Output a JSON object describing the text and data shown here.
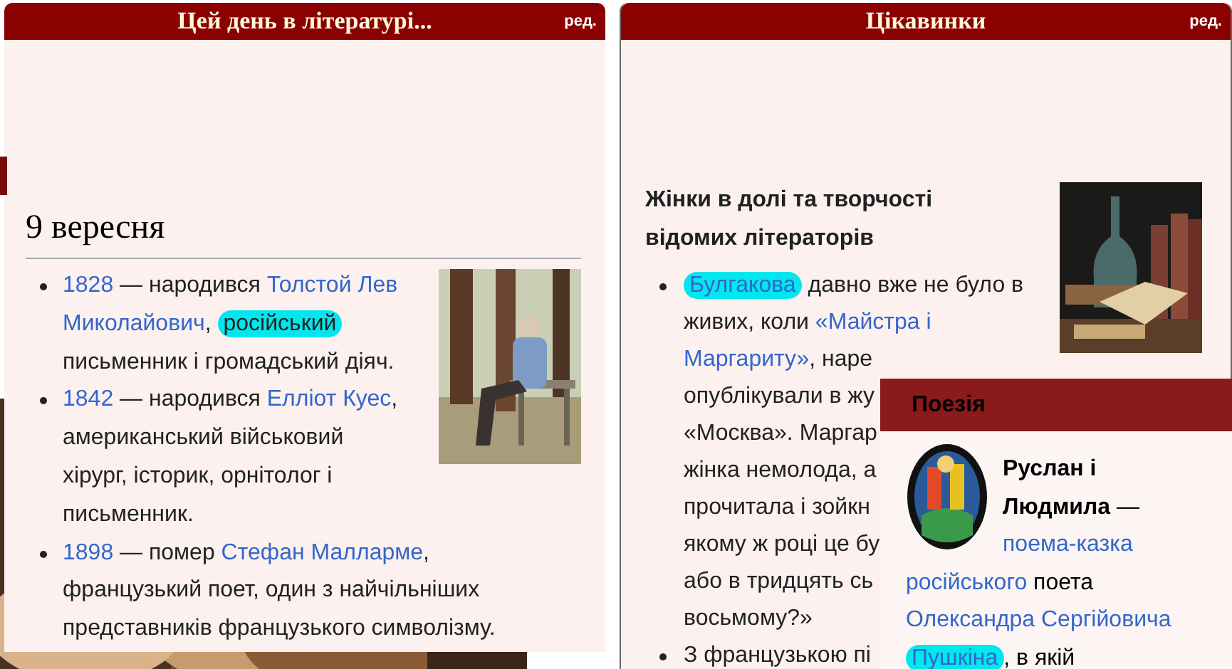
{
  "left_panel": {
    "title": "Цей день в літературі...",
    "edit_link": "ред.",
    "date_heading": "9 вересня",
    "items": [
      {
        "lines": [
          [
            {
              "kind": "link",
              "text": "1828"
            },
            {
              "kind": "text",
              "text": " — народився "
            },
            {
              "kind": "link",
              "text": "Толстой Лев"
            }
          ],
          [
            {
              "kind": "link",
              "text": "Миколайович"
            },
            {
              "kind": "text",
              "text": ", "
            },
            {
              "kind": "marked-text",
              "text": "російський"
            }
          ],
          [
            {
              "kind": "text",
              "text": "письменник і громадський діяч."
            }
          ]
        ]
      },
      {
        "lines": [
          [
            {
              "kind": "link",
              "text": "1842"
            },
            {
              "kind": "text",
              "text": " — народився "
            },
            {
              "kind": "link",
              "text": "Елліот Куес"
            },
            {
              "kind": "text",
              "text": ","
            }
          ],
          [
            {
              "kind": "text",
              "text": "американський військовий"
            }
          ],
          [
            {
              "kind": "text",
              "text": "хірург, історик, орнітолог і"
            }
          ],
          [
            {
              "kind": "text",
              "text": "письменник."
            }
          ]
        ]
      },
      {
        "lines": [
          [
            {
              "kind": "link",
              "text": "1898"
            },
            {
              "kind": "text",
              "text": " — помер "
            },
            {
              "kind": "link",
              "text": "Стефан Малларме"
            },
            {
              "kind": "text",
              "text": ","
            }
          ],
          [
            {
              "kind": "text",
              "text": "французький поет, один з найчільніших"
            }
          ],
          [
            {
              "kind": "text",
              "text": "представників французького символізму."
            }
          ]
        ]
      }
    ]
  },
  "right_panel": {
    "title": "Цікавинки",
    "edit_link": "ред.",
    "heading": "Жінки в долі та творчості відомих літераторів",
    "items": [
      {
        "lines": [
          [
            {
              "kind": "marked-link",
              "text": "Булгакова"
            },
            {
              "kind": "text",
              "text": " давно вже не було в"
            }
          ],
          [
            {
              "kind": "text",
              "text": "живих, коли "
            },
            {
              "kind": "link",
              "text": "«Майстра і"
            }
          ],
          [
            {
              "kind": "link",
              "text": "Маргариту»"
            },
            {
              "kind": "text",
              "text": ", наре"
            }
          ],
          [
            {
              "kind": "text",
              "text": "опублікували в жу"
            }
          ],
          [
            {
              "kind": "text",
              "text": "«Москва». Маргар"
            }
          ],
          [
            {
              "kind": "text",
              "text": "жінка немолода, а"
            }
          ],
          [
            {
              "kind": "text",
              "text": "прочитала і зойкн"
            }
          ],
          [
            {
              "kind": "text",
              "text": "якому ж році це бу"
            }
          ],
          [
            {
              "kind": "text",
              "text": "або в тридцять сь"
            }
          ],
          [
            {
              "kind": "text",
              "text": "восьмому?»"
            }
          ]
        ]
      },
      {
        "lines": [
          [
            {
              "kind": "text",
              "text": "З французькою пі"
            }
          ]
        ]
      }
    ]
  },
  "poetry_panel": {
    "title": "Поезія",
    "lines_beside_picture": [
      [
        {
          "kind": "bold",
          "text": "Руслан і"
        }
      ],
      [
        {
          "kind": "bold",
          "text": "Людмила"
        },
        {
          "kind": "text",
          "text": " —"
        }
      ],
      [
        {
          "kind": "link",
          "text": "поема-казка"
        }
      ]
    ],
    "lines_below": [
      [
        {
          "kind": "link",
          "text": "російського"
        },
        {
          "kind": "text",
          "text": " поета"
        }
      ],
      [
        {
          "kind": "link",
          "text": "Олександра Сергійовича"
        }
      ],
      [
        {
          "kind": "marked-link",
          "text": "Пушкіна"
        },
        {
          "kind": "text",
          "text": ", в якій"
        }
      ]
    ]
  }
}
